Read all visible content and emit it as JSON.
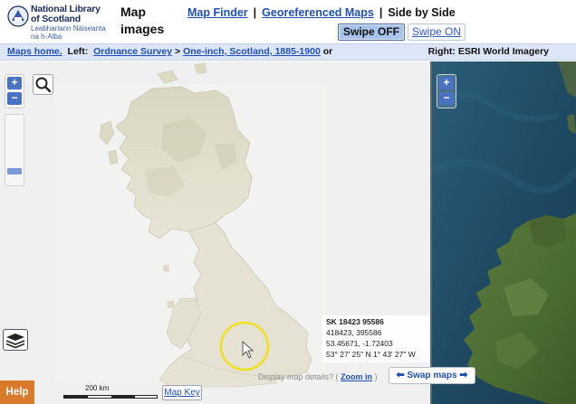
{
  "header": {
    "logo": {
      "title_line1": "National Library",
      "title_line2": "of Scotland",
      "gaelic_line1": "Leabharlann Nàiseanta",
      "gaelic_line2": "na h-Alba"
    },
    "app_title_line1": "Map",
    "app_title_line2": "images",
    "nav": {
      "map_finder": "Map Finder",
      "separator": "|",
      "georeferenced_maps": "Georeferenced Maps",
      "side_by_side": "Side by Side"
    },
    "swipe_off_label": "Swipe OFF",
    "swipe_on_label": "Swipe ON"
  },
  "breadcrumb": {
    "maps_home": "Maps home.",
    "left_prefix": "Left:",
    "ordnance_survey": "Ordnance Survey",
    "arrow": ">",
    "series": "One-inch, Scotland, 1885-1900",
    "or": "or",
    "right_label": "Right: ESRI World Imagery"
  },
  "left_map": {
    "zoom_in": "+",
    "zoom_out": "−",
    "help_label": "Help",
    "scale_label": "200 km",
    "map_key_label": "Map Key",
    "coordinates": {
      "grid_ref": "SK 18423 95586",
      "easting_northing": "418423, 395586",
      "lat_lon_decimal": "53.45671, -1.72403",
      "lat_lon_dms": "53° 27' 25\" N 1° 43' 27\" W"
    },
    "details_prompt": "Display map details? (",
    "zoom_in_link": "Zoom in",
    "details_close": ")",
    "swap_maps_label": "Swap maps"
  },
  "right_map": {
    "zoom_in": "+",
    "zoom_out": "−"
  },
  "colors": {
    "accent_blue": "#1f4fb5",
    "help_orange": "#d9792a",
    "cursor_highlight": "#f2e01c"
  }
}
